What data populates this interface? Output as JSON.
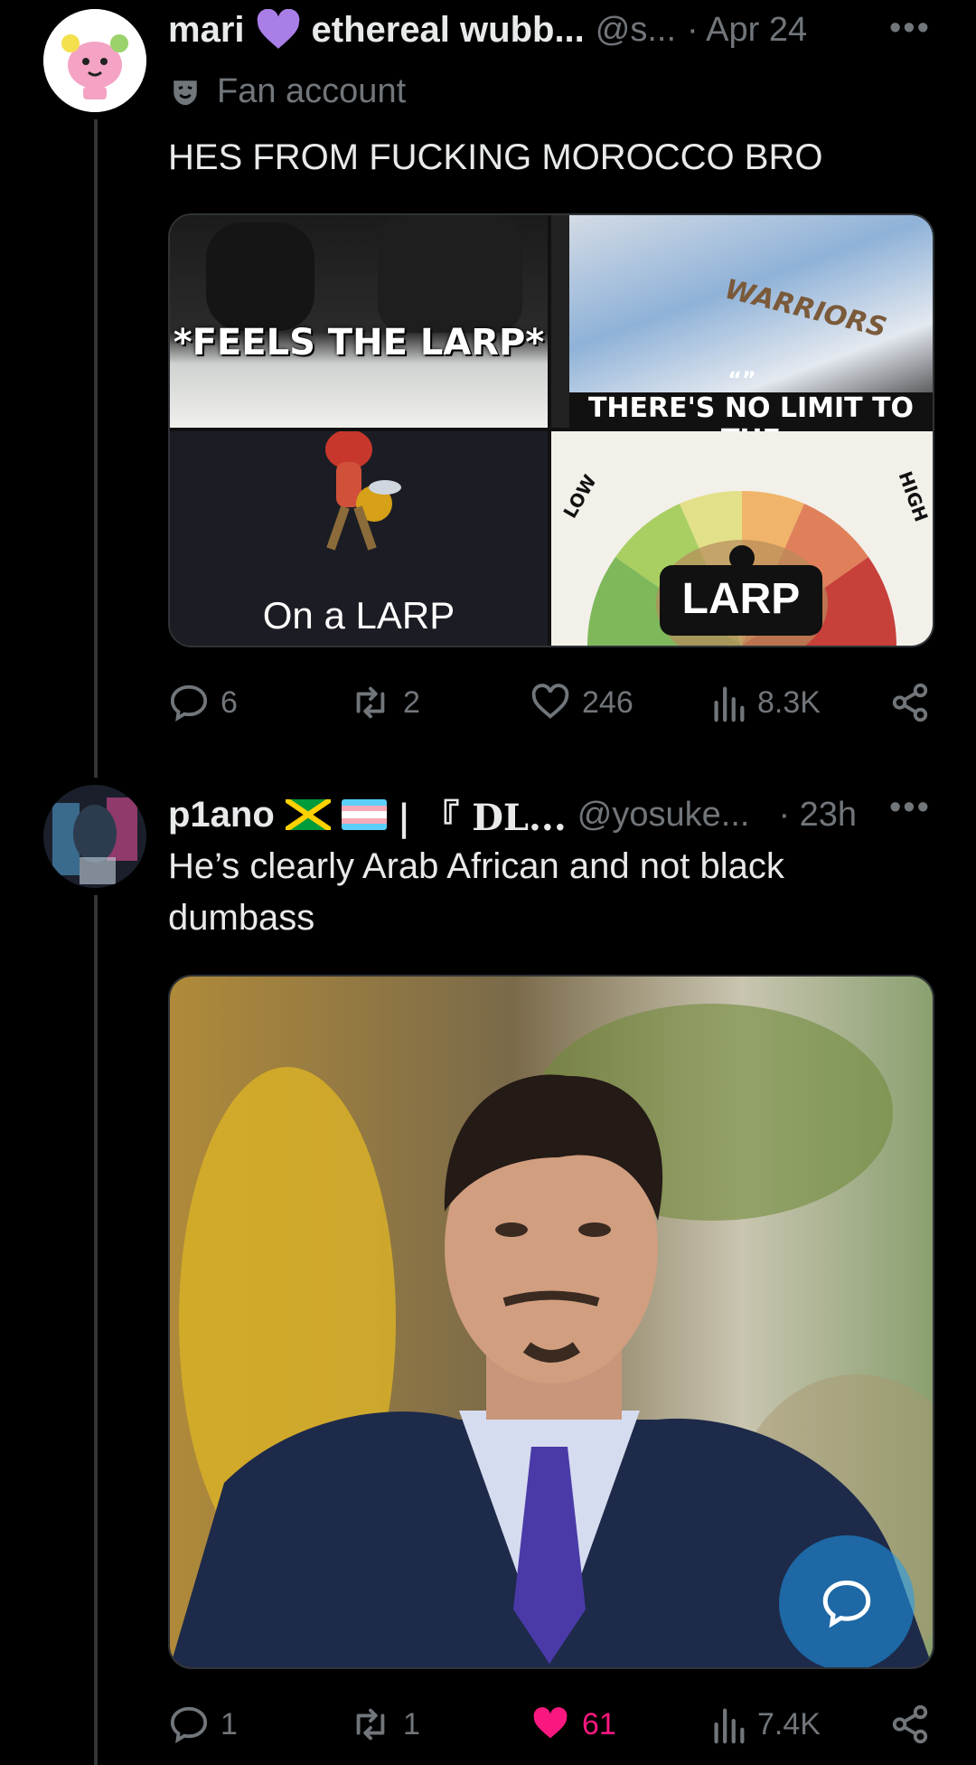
{
  "tweet1": {
    "display_name": "mari",
    "display_name_2": "ethereal wubb...",
    "handle": "@s...",
    "time": "· Apr 24",
    "label": "Fan account",
    "text": "HES FROM FUCKING MOROCCO BRO",
    "images": {
      "top_left_caption": "*FEELS THE LARP*",
      "top_right_caption": "THERE'S NO LIMIT TO THE",
      "top_right_shirt": "WARRIORS",
      "quote_mark": "“”",
      "bottom_left_caption": "On a LARP",
      "gauge_low": "LOW",
      "gauge_high": "HIGH",
      "gauge_label": "LARP"
    },
    "actions": {
      "replies": "6",
      "reposts": "2",
      "likes": "246",
      "views": "8.3K"
    }
  },
  "tweet2": {
    "display_name": "p1ano",
    "display_name_2": "| 『 DL...",
    "handle": "@yosuke...",
    "time": "· 23h",
    "text_line1": "He’s clearly Arab African and not black",
    "text_line2": "dumbass",
    "actions": {
      "replies": "1",
      "reposts": "1",
      "likes": "61",
      "views": "7.4K"
    }
  },
  "icons": {
    "heart_badge": "purple-heart-icon",
    "fan_label": "theater-mask-icon",
    "flag1": "jamaica-flag-icon",
    "flag2": "trans-flag-icon",
    "fab": "compose-reply-icon"
  },
  "colors": {
    "liked": "#f91880",
    "muted": "#71767b",
    "heart_badge": "#a97ee6"
  }
}
